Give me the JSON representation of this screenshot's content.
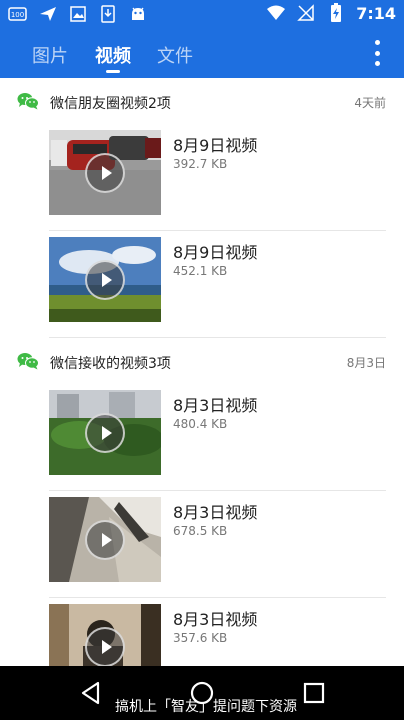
{
  "status_bar": {
    "time": "7:14",
    "badge": "100"
  },
  "tabs": [
    {
      "label": "图片"
    },
    {
      "label": "视频"
    },
    {
      "label": "文件"
    }
  ],
  "groups": [
    {
      "title": "微信朋友圈视频2项",
      "date": "4天前",
      "items": [
        {
          "title": "8月9日视频",
          "size": "392.7 KB"
        },
        {
          "title": "8月9日视频",
          "size": "452.1 KB"
        }
      ]
    },
    {
      "title": "微信接收的视频3项",
      "date": "8月3日",
      "items": [
        {
          "title": "8月3日视频",
          "size": "480.4 KB"
        },
        {
          "title": "8月3日视频",
          "size": "678.5 KB"
        },
        {
          "title": "8月3日视频",
          "size": "357.6 KB"
        }
      ]
    }
  ],
  "watermark": "搞机上「智友」提问题下资源",
  "colors": {
    "accent": "#1e6fe0",
    "wechat": "#3fba45"
  }
}
